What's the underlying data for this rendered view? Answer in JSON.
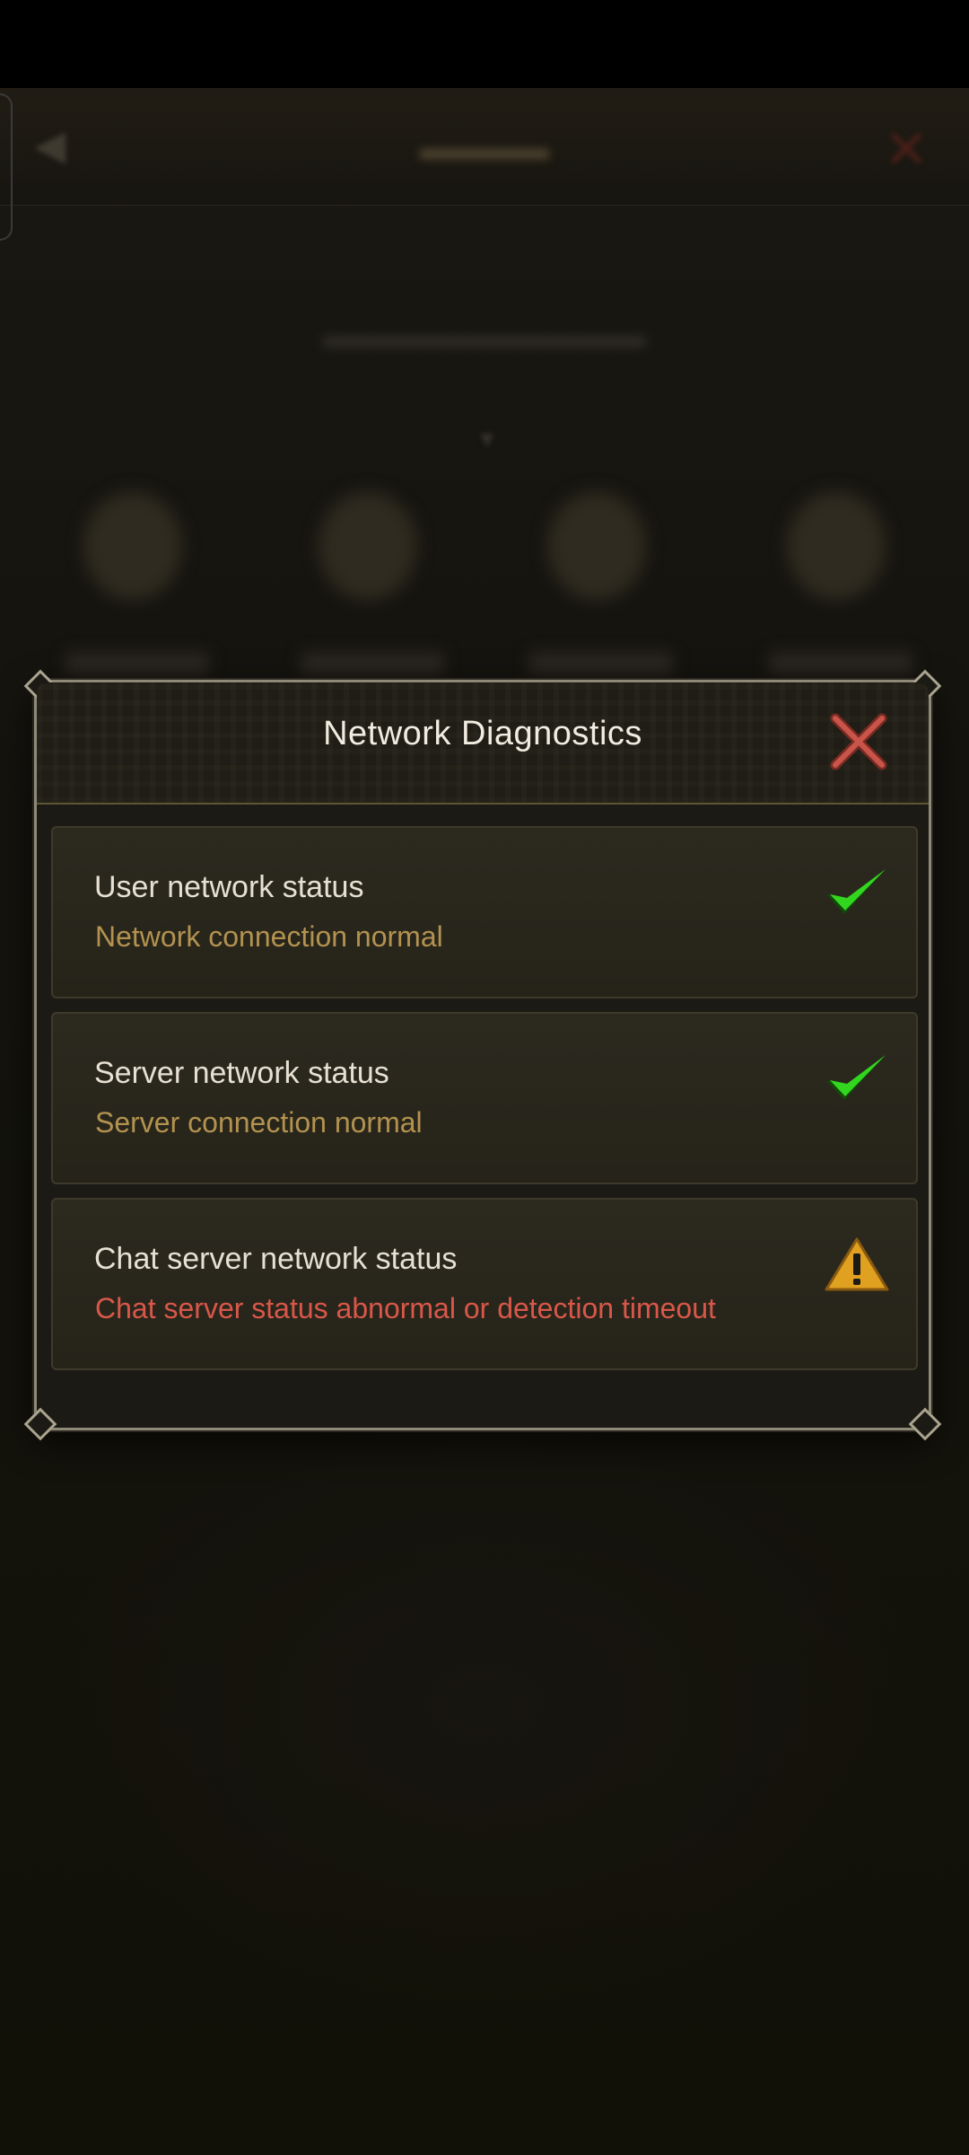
{
  "dialog": {
    "title": "Network Diagnostics",
    "close_icon": "close-icon",
    "items": [
      {
        "title": "User network status",
        "status": "Network connection normal",
        "state": "ok",
        "icon": "check-icon"
      },
      {
        "title": "Server network status",
        "status": "Server connection normal",
        "state": "ok",
        "icon": "check-icon"
      },
      {
        "title": "Chat server network status",
        "status": "Chat server status abnormal or detection timeout",
        "state": "warning",
        "icon": "warning-icon"
      }
    ]
  },
  "colors": {
    "ok_text": "#b39250",
    "error_text": "#d9574a",
    "check_green": "#33d61f",
    "warning_amber": "#e0a020",
    "close_red": "#c9554a"
  }
}
